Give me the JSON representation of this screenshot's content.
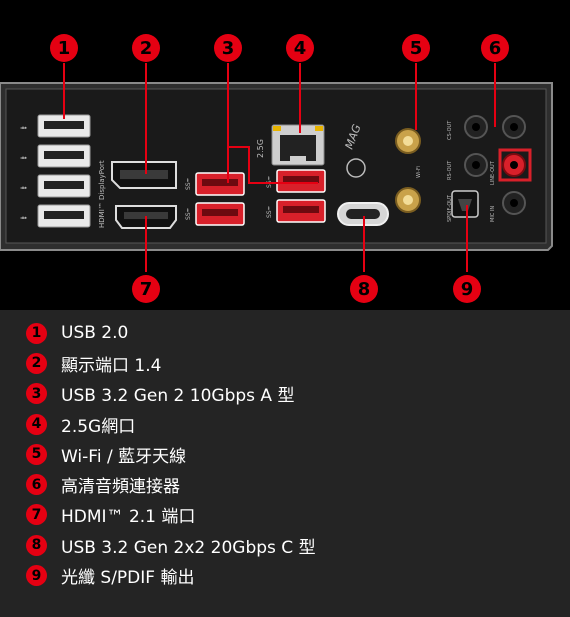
{
  "panel": {
    "brand_logo_text": "MAG",
    "lan_label": "2.5G",
    "hdmi_label": "HDMI™",
    "dp_label": "DisplayPort",
    "wifi_label": "Wi-Fi"
  },
  "callouts": [
    "1",
    "2",
    "3",
    "4",
    "5",
    "6",
    "7",
    "8",
    "9"
  ],
  "legend": [
    {
      "num": "1",
      "label": "USB 2.0"
    },
    {
      "num": "2",
      "label": "顯示端口 1.4"
    },
    {
      "num": "3",
      "label": "USB 3.2 Gen 2 10Gbps A 型"
    },
    {
      "num": "4",
      "label": "2.5G網口"
    },
    {
      "num": "5",
      "label": "Wi-Fi / 藍牙天線"
    },
    {
      "num": "6",
      "label": "高清音頻連接器"
    },
    {
      "num": "7",
      "label": "HDMI™ 2.1 端口"
    },
    {
      "num": "8",
      "label": "USB 3.2 Gen 2x2 20Gbps C 型"
    },
    {
      "num": "9",
      "label": "光纖 S/PDIF 輸出"
    }
  ],
  "colors": {
    "callout_red": "#e50012",
    "legend_bg": "#242424",
    "usb3_red": "#d8202a",
    "panel_gray": "#1c1c1c",
    "gold": "#c9a24a"
  }
}
